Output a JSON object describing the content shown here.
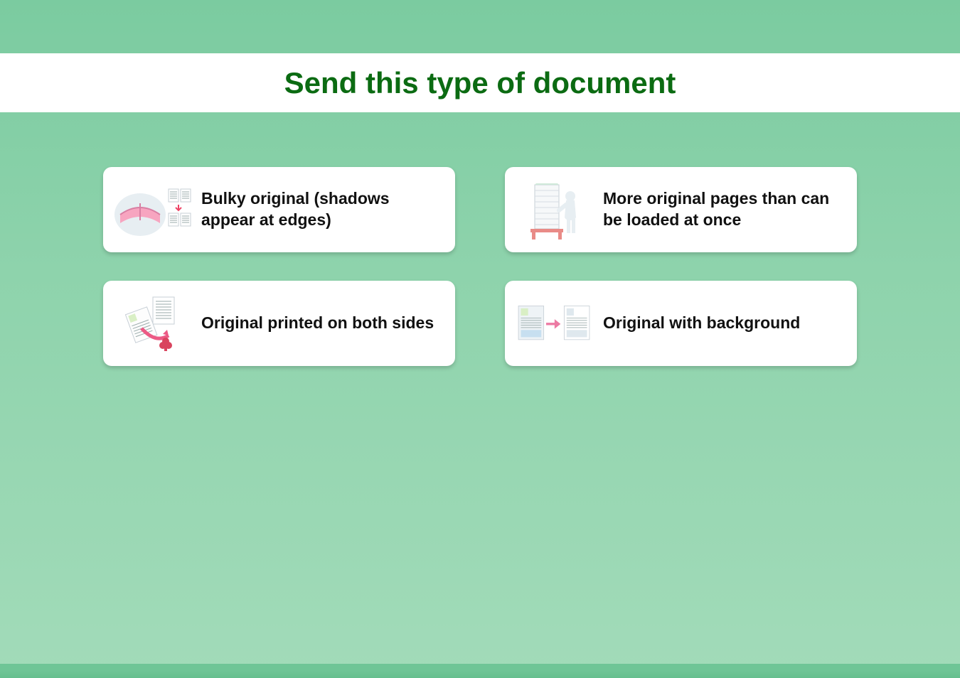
{
  "header": {
    "title": "Send this type of document"
  },
  "options": [
    {
      "id": "bulky-original",
      "label": "Bulky original (shadows appear at edges)"
    },
    {
      "id": "more-pages",
      "label": "More original pages than can be loaded at once"
    },
    {
      "id": "two-sided",
      "label": "Original printed on both sides"
    },
    {
      "id": "with-background",
      "label": "Original with background"
    }
  ]
}
